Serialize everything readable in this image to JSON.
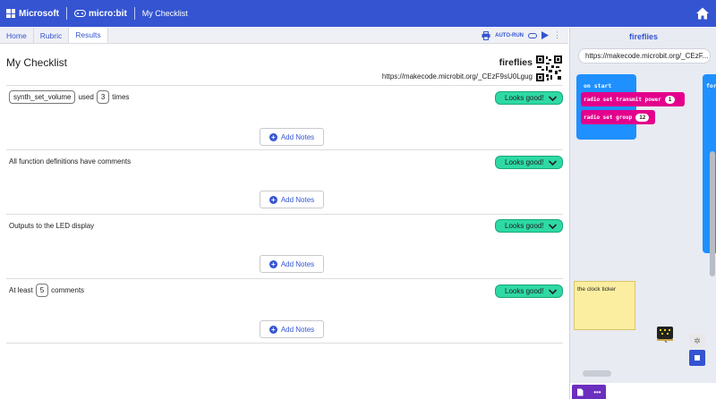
{
  "topbar": {
    "brand": "Microsoft",
    "product": "micro:bit",
    "title": "My Checklist"
  },
  "tabs": [
    {
      "label": "Home"
    },
    {
      "label": "Rubric"
    },
    {
      "label": "Results"
    }
  ],
  "toolbar": {
    "autorun_label": "AUTO-RUN"
  },
  "checklist": {
    "heading": "My Checklist",
    "project_name": "fireflies",
    "project_url": "https://makecode.microbit.org/_CEzF9sU0Lgug",
    "add_notes_label": "Add Notes",
    "criteria": [
      {
        "pill": "synth_set_volume",
        "middle": "used",
        "count": "3",
        "tail": "times",
        "status": "Looks good!"
      },
      {
        "text": "All function definitions have comments",
        "status": "Looks good!"
      },
      {
        "text": "Outputs to the LED display",
        "status": "Looks good!"
      },
      {
        "head": "At least",
        "count": "5",
        "tail": "comments",
        "status": "Looks good!"
      }
    ]
  },
  "preview": {
    "title": "fireflies",
    "url": "https://makecode.microbit.org/_CEzF...",
    "blocks": {
      "on_start": "on start",
      "radio_power": "radio set transmit power",
      "radio_power_value": "1",
      "radio_group": "radio set group",
      "radio_group_value": "12",
      "forever": "fore"
    },
    "note": "the clock ticker"
  },
  "colors": {
    "topbar": "#3454d1",
    "status_good": "#2ed9a4",
    "block_blue": "#1e90ff",
    "block_radio": "#e3008c",
    "note": "#fbeea0"
  }
}
